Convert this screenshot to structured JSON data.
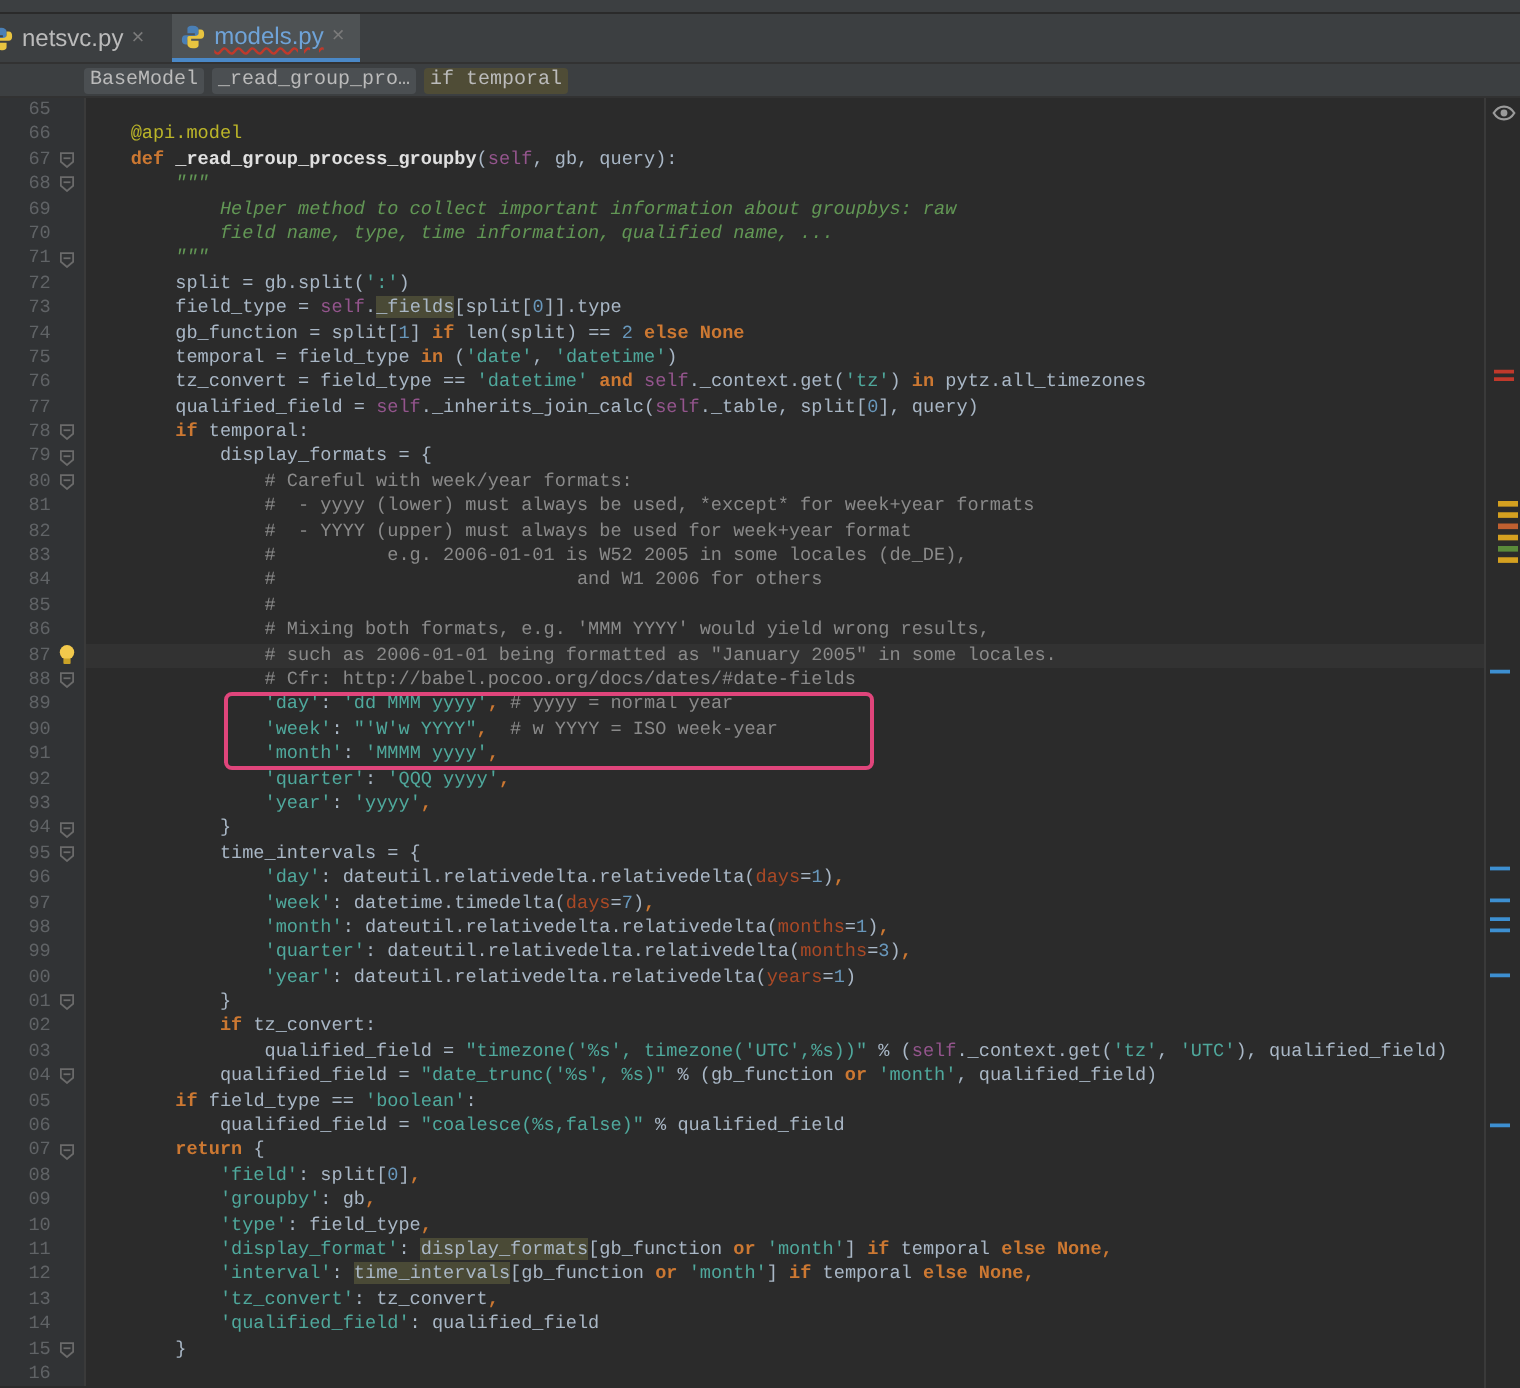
{
  "tabs": [
    {
      "label": "netsvc.py",
      "close": "×",
      "selected": false
    },
    {
      "label": "models.py",
      "close": "×",
      "selected": true
    }
  ],
  "breadcrumbs": [
    {
      "label": "BaseModel",
      "selected": false
    },
    {
      "label": "_read_group_pro…",
      "selected": false
    },
    {
      "label": "if temporal",
      "selected": true
    }
  ],
  "lines": [
    {
      "number": "65",
      "fold": false,
      "current": false,
      "boxed": false
    },
    {
      "number": "66",
      "fold": false,
      "current": false,
      "boxed": false,
      "tokens": [
        {
          "text": "    @api.model",
          "kind": "decorator"
        }
      ]
    },
    {
      "number": "67",
      "fold": true,
      "current": false,
      "boxed": false,
      "tokens": [
        {
          "text": "    def",
          "kind": "keyword"
        },
        {
          "text": " _read_group_process_groupby",
          "kind": "function"
        },
        {
          "text": "(",
          "kind": "plain"
        },
        {
          "text": "self",
          "kind": "self"
        },
        {
          "text": ", gb, query):",
          "kind": "plain"
        }
      ]
    },
    {
      "number": "68",
      "fold": true,
      "current": false,
      "boxed": false,
      "tokens": [
        {
          "text": "        \"\"\"",
          "kind": "doc"
        }
      ]
    },
    {
      "number": "69",
      "fold": false,
      "current": false,
      "boxed": false,
      "tokens": [
        {
          "text": "            Helper method to collect important information about groupbys: raw",
          "kind": "doc"
        }
      ]
    },
    {
      "number": "70",
      "fold": false,
      "current": false,
      "boxed": false,
      "tokens": [
        {
          "text": "            field name, type, time information, qualified name, ...",
          "kind": "doc"
        }
      ]
    },
    {
      "number": "71",
      "fold": true,
      "current": false,
      "boxed": false,
      "tokens": [
        {
          "text": "        \"\"\"",
          "kind": "doc"
        }
      ]
    },
    {
      "number": "72",
      "fold": false,
      "current": false,
      "boxed": false,
      "tokens": [
        {
          "text": "        split = gb.split(",
          "kind": "plain"
        },
        {
          "text": "':'",
          "kind": "string"
        },
        {
          "text": ")",
          "kind": "plain"
        }
      ]
    },
    {
      "number": "73",
      "fold": false,
      "current": false,
      "boxed": false,
      "tokens": [
        {
          "text": "        field_type = ",
          "kind": "plain"
        },
        {
          "text": "self",
          "kind": "self"
        },
        {
          "text": ".",
          "kind": "plain"
        },
        {
          "text": "_fields",
          "kind": "usage"
        },
        {
          "text": "[split[",
          "kind": "plain"
        },
        {
          "text": "0",
          "kind": "number"
        },
        {
          "text": "]].type",
          "kind": "plain"
        }
      ]
    },
    {
      "number": "74",
      "fold": false,
      "current": false,
      "boxed": false,
      "tokens": [
        {
          "text": "        gb_function = split[",
          "kind": "plain"
        },
        {
          "text": "1",
          "kind": "number"
        },
        {
          "text": "] ",
          "kind": "plain"
        },
        {
          "text": "if",
          "kind": "keyword"
        },
        {
          "text": " len(split) == ",
          "kind": "plain"
        },
        {
          "text": "2",
          "kind": "number"
        },
        {
          "text": " else None",
          "kind": "keyword"
        }
      ]
    },
    {
      "number": "75",
      "fold": false,
      "current": false,
      "boxed": false,
      "tokens": [
        {
          "text": "        temporal = field_type ",
          "kind": "plain"
        },
        {
          "text": "in",
          "kind": "keyword"
        },
        {
          "text": " (",
          "kind": "plain"
        },
        {
          "text": "'date'",
          "kind": "string"
        },
        {
          "text": ", ",
          "kind": "plain"
        },
        {
          "text": "'datetime'",
          "kind": "string"
        },
        {
          "text": ")",
          "kind": "plain"
        }
      ]
    },
    {
      "number": "76",
      "fold": false,
      "current": false,
      "boxed": false,
      "tokens": [
        {
          "text": "        tz_convert = field_type == ",
          "kind": "plain"
        },
        {
          "text": "'datetime'",
          "kind": "string"
        },
        {
          "text": " and",
          "kind": "keyword"
        },
        {
          "text": " self",
          "kind": "self"
        },
        {
          "text": "._context.get(",
          "kind": "plain"
        },
        {
          "text": "'tz'",
          "kind": "string"
        },
        {
          "text": ") ",
          "kind": "plain"
        },
        {
          "text": "in",
          "kind": "keyword"
        },
        {
          "text": " pytz.all_timezones",
          "kind": "plain"
        }
      ]
    },
    {
      "number": "77",
      "fold": false,
      "current": false,
      "boxed": false,
      "tokens": [
        {
          "text": "        qualified_field = ",
          "kind": "plain"
        },
        {
          "text": "self",
          "kind": "self"
        },
        {
          "text": "._inherits_join_calc(",
          "kind": "plain"
        },
        {
          "text": "self",
          "kind": "self"
        },
        {
          "text": "._table, split[",
          "kind": "plain"
        },
        {
          "text": "0",
          "kind": "number"
        },
        {
          "text": "], query)",
          "kind": "plain"
        }
      ]
    },
    {
      "number": "78",
      "fold": true,
      "current": false,
      "boxed": false,
      "tokens": [
        {
          "text": "        if",
          "kind": "keyword"
        },
        {
          "text": " temporal:",
          "kind": "plain"
        }
      ]
    },
    {
      "number": "79",
      "fold": true,
      "current": false,
      "boxed": false,
      "tokens": [
        {
          "text": "            display_formats = {",
          "kind": "plain"
        }
      ]
    },
    {
      "number": "80",
      "fold": true,
      "current": false,
      "boxed": false,
      "tokens": [
        {
          "text": "                # Careful with week/year formats:",
          "kind": "comment"
        }
      ]
    },
    {
      "number": "81",
      "fold": false,
      "current": false,
      "boxed": false,
      "tokens": [
        {
          "text": "                #  - yyyy (lower) must always be used, *except* for week+year formats",
          "kind": "comment"
        }
      ]
    },
    {
      "number": "82",
      "fold": false,
      "current": false,
      "boxed": false,
      "tokens": [
        {
          "text": "                #  - YYYY (upper) must always be used for week+year format",
          "kind": "comment"
        }
      ]
    },
    {
      "number": "83",
      "fold": false,
      "current": false,
      "boxed": false,
      "tokens": [
        {
          "text": "                #          e.g. 2006-01-01 is W52 2005 in some locales (de_DE),",
          "kind": "comment"
        }
      ]
    },
    {
      "number": "84",
      "fold": false,
      "current": false,
      "boxed": false,
      "tokens": [
        {
          "text": "                #                           and W1 2006 for others",
          "kind": "comment"
        }
      ]
    },
    {
      "number": "85",
      "fold": false,
      "current": false,
      "boxed": false,
      "tokens": [
        {
          "text": "                #",
          "kind": "comment"
        }
      ]
    },
    {
      "number": "86",
      "fold": false,
      "current": false,
      "boxed": false,
      "tokens": [
        {
          "text": "                # Mixing both formats, e.g. 'MMM YYYY' would yield wrong results,",
          "kind": "comment"
        }
      ]
    },
    {
      "number": "87",
      "fold": false,
      "current": true,
      "boxed": false,
      "tokens": [
        {
          "text": "                # such as 2006-01-01 being formatted as \"January 2005\" in some locales.",
          "kind": "comment"
        }
      ]
    },
    {
      "number": "88",
      "fold": true,
      "current": false,
      "boxed": false,
      "tokens": [
        {
          "text": "                # Cfr: http://babel.pocoo.org/docs/dates/#date-fields",
          "kind": "comment"
        }
      ]
    },
    {
      "number": "89",
      "fold": false,
      "current": false,
      "boxed": true,
      "tokens": [
        {
          "text": "                'day'",
          "kind": "string"
        },
        {
          "text": ": ",
          "kind": "plain"
        },
        {
          "text": "'dd MMM yyyy'",
          "kind": "string"
        },
        {
          "text": ",",
          "kind": "keyword"
        },
        {
          "text": " # yyyy = normal year",
          "kind": "comment"
        }
      ]
    },
    {
      "number": "90",
      "fold": false,
      "current": false,
      "boxed": true,
      "tokens": [
        {
          "text": "                'week'",
          "kind": "string"
        },
        {
          "text": ": ",
          "kind": "plain"
        },
        {
          "text": "\"'W'w YYYY\"",
          "kind": "string"
        },
        {
          "text": ",",
          "kind": "keyword"
        },
        {
          "text": "  # w YYYY = ISO week-year",
          "kind": "comment"
        }
      ]
    },
    {
      "number": "91",
      "fold": false,
      "current": false,
      "boxed": true,
      "tokens": [
        {
          "text": "                'month'",
          "kind": "string"
        },
        {
          "text": ": ",
          "kind": "plain"
        },
        {
          "text": "'MMMM yyyy'",
          "kind": "string"
        },
        {
          "text": ",",
          "kind": "keyword"
        }
      ]
    },
    {
      "number": "92",
      "fold": false,
      "current": false,
      "boxed": false,
      "tokens": [
        {
          "text": "                'quarter'",
          "kind": "string"
        },
        {
          "text": ": ",
          "kind": "plain"
        },
        {
          "text": "'QQQ yyyy'",
          "kind": "string"
        },
        {
          "text": ",",
          "kind": "keyword"
        }
      ]
    },
    {
      "number": "93",
      "fold": false,
      "current": false,
      "boxed": false,
      "tokens": [
        {
          "text": "                'year'",
          "kind": "string"
        },
        {
          "text": ": ",
          "kind": "plain"
        },
        {
          "text": "'yyyy'",
          "kind": "string"
        },
        {
          "text": ",",
          "kind": "keyword"
        }
      ]
    },
    {
      "number": "94",
      "fold": true,
      "current": false,
      "boxed": false,
      "tokens": [
        {
          "text": "            }",
          "kind": "plain"
        }
      ]
    },
    {
      "number": "95",
      "fold": true,
      "current": false,
      "boxed": false,
      "tokens": [
        {
          "text": "            time_intervals = {",
          "kind": "plain"
        }
      ]
    },
    {
      "number": "96",
      "fold": false,
      "current": false,
      "boxed": false,
      "tokens": [
        {
          "text": "                'day'",
          "kind": "string"
        },
        {
          "text": ": dateutil.relativedelta.relativedelta(",
          "kind": "plain"
        },
        {
          "text": "days",
          "kind": "param"
        },
        {
          "text": "=",
          "kind": "plain"
        },
        {
          "text": "1",
          "kind": "number"
        },
        {
          "text": ")",
          "kind": "plain"
        },
        {
          "text": ",",
          "kind": "keyword"
        }
      ]
    },
    {
      "number": "97",
      "fold": false,
      "current": false,
      "boxed": false,
      "tokens": [
        {
          "text": "                'week'",
          "kind": "string"
        },
        {
          "text": ": datetime.timedelta(",
          "kind": "plain"
        },
        {
          "text": "days",
          "kind": "param"
        },
        {
          "text": "=",
          "kind": "plain"
        },
        {
          "text": "7",
          "kind": "number"
        },
        {
          "text": ")",
          "kind": "plain"
        },
        {
          "text": ",",
          "kind": "keyword"
        }
      ]
    },
    {
      "number": "98",
      "fold": false,
      "current": false,
      "boxed": false,
      "tokens": [
        {
          "text": "                'month'",
          "kind": "string"
        },
        {
          "text": ": dateutil.relativedelta.relativedelta(",
          "kind": "plain"
        },
        {
          "text": "months",
          "kind": "param"
        },
        {
          "text": "=",
          "kind": "plain"
        },
        {
          "text": "1",
          "kind": "number"
        },
        {
          "text": ")",
          "kind": "plain"
        },
        {
          "text": ",",
          "kind": "keyword"
        }
      ]
    },
    {
      "number": "99",
      "fold": false,
      "current": false,
      "boxed": false,
      "tokens": [
        {
          "text": "                'quarter'",
          "kind": "string"
        },
        {
          "text": ": dateutil.relativedelta.relativedelta(",
          "kind": "plain"
        },
        {
          "text": "months",
          "kind": "param"
        },
        {
          "text": "=",
          "kind": "plain"
        },
        {
          "text": "3",
          "kind": "number"
        },
        {
          "text": ")",
          "kind": "plain"
        },
        {
          "text": ",",
          "kind": "keyword"
        }
      ]
    },
    {
      "number": "00",
      "fold": false,
      "current": false,
      "boxed": false,
      "tokens": [
        {
          "text": "                'year'",
          "kind": "string"
        },
        {
          "text": ": dateutil.relativedelta.relativedelta(",
          "kind": "plain"
        },
        {
          "text": "years",
          "kind": "param"
        },
        {
          "text": "=",
          "kind": "plain"
        },
        {
          "text": "1",
          "kind": "number"
        },
        {
          "text": ")",
          "kind": "plain"
        }
      ]
    },
    {
      "number": "01",
      "fold": true,
      "current": false,
      "boxed": false,
      "tokens": [
        {
          "text": "            }",
          "kind": "plain"
        }
      ]
    },
    {
      "number": "02",
      "fold": false,
      "current": false,
      "boxed": false,
      "tokens": [
        {
          "text": "            if",
          "kind": "keyword"
        },
        {
          "text": " tz_convert:",
          "kind": "plain"
        }
      ]
    },
    {
      "number": "03",
      "fold": false,
      "current": false,
      "boxed": false,
      "tokens": [
        {
          "text": "                qualified_field = ",
          "kind": "plain"
        },
        {
          "text": "\"timezone('%s', timezone('UTC',%s))\"",
          "kind": "string"
        },
        {
          "text": " % (",
          "kind": "plain"
        },
        {
          "text": "self",
          "kind": "self"
        },
        {
          "text": "._context.get(",
          "kind": "plain"
        },
        {
          "text": "'tz'",
          "kind": "string"
        },
        {
          "text": ", ",
          "kind": "plain"
        },
        {
          "text": "'UTC'",
          "kind": "string"
        },
        {
          "text": "), qualified_field)",
          "kind": "plain"
        }
      ]
    },
    {
      "number": "04",
      "fold": true,
      "current": false,
      "boxed": false,
      "tokens": [
        {
          "text": "            qualified_field = ",
          "kind": "plain"
        },
        {
          "text": "\"date_trunc('%s', %s)\"",
          "kind": "string"
        },
        {
          "text": " % (gb_function ",
          "kind": "plain"
        },
        {
          "text": "or",
          "kind": "keyword"
        },
        {
          "text": " 'month'",
          "kind": "string"
        },
        {
          "text": ", qualified_field)",
          "kind": "plain"
        }
      ]
    },
    {
      "number": "05",
      "fold": false,
      "current": false,
      "boxed": false,
      "tokens": [
        {
          "text": "        if",
          "kind": "keyword"
        },
        {
          "text": " field_type == ",
          "kind": "plain"
        },
        {
          "text": "'boolean'",
          "kind": "string"
        },
        {
          "text": ":",
          "kind": "plain"
        }
      ]
    },
    {
      "number": "06",
      "fold": false,
      "current": false,
      "boxed": false,
      "tokens": [
        {
          "text": "            qualified_field = ",
          "kind": "plain"
        },
        {
          "text": "\"coalesce(%s,false)\"",
          "kind": "string"
        },
        {
          "text": " % qualified_field",
          "kind": "plain"
        }
      ]
    },
    {
      "number": "07",
      "fold": true,
      "current": false,
      "boxed": false,
      "tokens": [
        {
          "text": "        return",
          "kind": "keyword"
        },
        {
          "text": " {",
          "kind": "plain"
        }
      ]
    },
    {
      "number": "08",
      "fold": false,
      "current": false,
      "boxed": false,
      "tokens": [
        {
          "text": "            'field'",
          "kind": "string"
        },
        {
          "text": ": split[",
          "kind": "plain"
        },
        {
          "text": "0",
          "kind": "number"
        },
        {
          "text": "]",
          "kind": "plain"
        },
        {
          "text": ",",
          "kind": "keyword"
        }
      ]
    },
    {
      "number": "09",
      "fold": false,
      "current": false,
      "boxed": false,
      "tokens": [
        {
          "text": "            'groupby'",
          "kind": "string"
        },
        {
          "text": ": gb",
          "kind": "plain"
        },
        {
          "text": ",",
          "kind": "keyword"
        }
      ]
    },
    {
      "number": "10",
      "fold": false,
      "current": false,
      "boxed": false,
      "tokens": [
        {
          "text": "            'type'",
          "kind": "string"
        },
        {
          "text": ": field_type",
          "kind": "plain"
        },
        {
          "text": ",",
          "kind": "keyword"
        }
      ]
    },
    {
      "number": "11",
      "fold": false,
      "current": false,
      "boxed": false,
      "tokens": [
        {
          "text": "            'display_format'",
          "kind": "string"
        },
        {
          "text": ": ",
          "kind": "plain"
        },
        {
          "text": "display_formats",
          "kind": "usage"
        },
        {
          "text": "[gb_function ",
          "kind": "plain"
        },
        {
          "text": "or",
          "kind": "keyword"
        },
        {
          "text": " 'month'",
          "kind": "string"
        },
        {
          "text": "] ",
          "kind": "plain"
        },
        {
          "text": "if",
          "kind": "keyword"
        },
        {
          "text": " temporal ",
          "kind": "plain"
        },
        {
          "text": "else None,",
          "kind": "keyword"
        }
      ]
    },
    {
      "number": "12",
      "fold": false,
      "current": false,
      "boxed": false,
      "tokens": [
        {
          "text": "            'interval'",
          "kind": "string"
        },
        {
          "text": ": ",
          "kind": "plain"
        },
        {
          "text": "time_intervals",
          "kind": "usage"
        },
        {
          "text": "[gb_function ",
          "kind": "plain"
        },
        {
          "text": "or",
          "kind": "keyword"
        },
        {
          "text": " 'month'",
          "kind": "string"
        },
        {
          "text": "] ",
          "kind": "plain"
        },
        {
          "text": "if",
          "kind": "keyword"
        },
        {
          "text": " temporal ",
          "kind": "plain"
        },
        {
          "text": "else None,",
          "kind": "keyword"
        }
      ]
    },
    {
      "number": "13",
      "fold": false,
      "current": false,
      "boxed": false,
      "tokens": [
        {
          "text": "            'tz_convert'",
          "kind": "string"
        },
        {
          "text": ": tz_convert",
          "kind": "plain"
        },
        {
          "text": ",",
          "kind": "keyword"
        }
      ]
    },
    {
      "number": "14",
      "fold": false,
      "current": false,
      "boxed": false,
      "tokens": [
        {
          "text": "            'qualified_field'",
          "kind": "string"
        },
        {
          "text": ": qualified_field",
          "kind": "plain"
        }
      ]
    },
    {
      "number": "15",
      "fold": true,
      "current": false,
      "boxed": false,
      "tokens": [
        {
          "text": "        }",
          "kind": "plain"
        }
      ]
    },
    {
      "number": "16",
      "fold": false,
      "current": false,
      "boxed": false
    }
  ]
}
